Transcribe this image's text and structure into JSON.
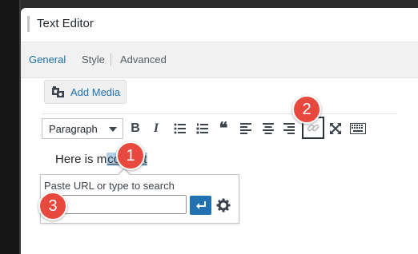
{
  "window": {
    "title": "Text Editor"
  },
  "tabs": [
    {
      "label": "General"
    },
    {
      "label": "Style"
    },
    {
      "label": "Advanced"
    }
  ],
  "buttons": {
    "add_media": "Add Media"
  },
  "toolbar": {
    "format_value": "Paragraph",
    "icons": [
      "bold-icon",
      "italic-icon",
      "bullet-list-icon",
      "numbered-list-icon",
      "blockquote-icon",
      "align-left-icon",
      "align-center-icon",
      "align-right-icon",
      "insert-link-icon",
      "fullscreen-icon",
      "toolbar-toggle-icon"
    ],
    "bold_glyph": "B",
    "italic_glyph": "I",
    "quote_glyph": "❝"
  },
  "editor": {
    "text_before": "Here is ",
    "text_partial": "m",
    "text_selected": "content"
  },
  "link_popover": {
    "placeholder_label": "Paste URL or type to search",
    "url_value": ""
  },
  "callouts": [
    "1",
    "2",
    "3"
  ],
  "colors": {
    "accent": "#2271b1",
    "callout": "#e8493f",
    "selection": "#b4d0e6"
  }
}
